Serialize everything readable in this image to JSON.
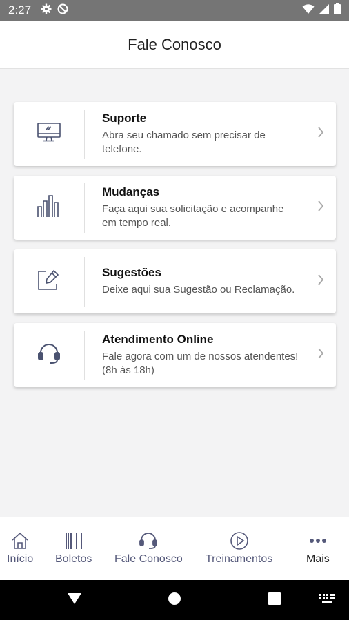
{
  "status_bar": {
    "time": "2:27",
    "left_icons": [
      "gear-icon",
      "do-not-disturb-icon"
    ],
    "right_icons": [
      "wifi-icon",
      "signal-icon",
      "battery-icon"
    ]
  },
  "header": {
    "title": "Fale Conosco"
  },
  "cards": [
    {
      "title": "Suporte",
      "description": "Abra seu chamado sem precisar de telefone.",
      "icon": "monitor-icon"
    },
    {
      "title": "Mudanças",
      "description": "Faça aqui sua solicitação e acompanhe em tempo real.",
      "icon": "bar-chart-icon"
    },
    {
      "title": "Sugestões",
      "description": "Deixe aqui sua Sugestão ou Reclamação.",
      "icon": "edit-icon"
    },
    {
      "title": "Atendimento Online",
      "description": "Fale agora com um de nossos atendentes! (8h às 18h)",
      "icon": "headset-icon"
    }
  ],
  "bottom_nav": {
    "items": [
      {
        "label": "Início",
        "icon": "home-icon"
      },
      {
        "label": "Boletos",
        "icon": "barcode-icon"
      },
      {
        "label": "Fale Conosco",
        "icon": "headset-icon"
      },
      {
        "label": "Treinamentos",
        "icon": "play-icon"
      },
      {
        "label": "Mais",
        "icon": "more-icon"
      }
    ]
  },
  "colors": {
    "icon_stroke": "#4a5270",
    "status_bar": "#757575",
    "background": "#f3f3f4"
  }
}
